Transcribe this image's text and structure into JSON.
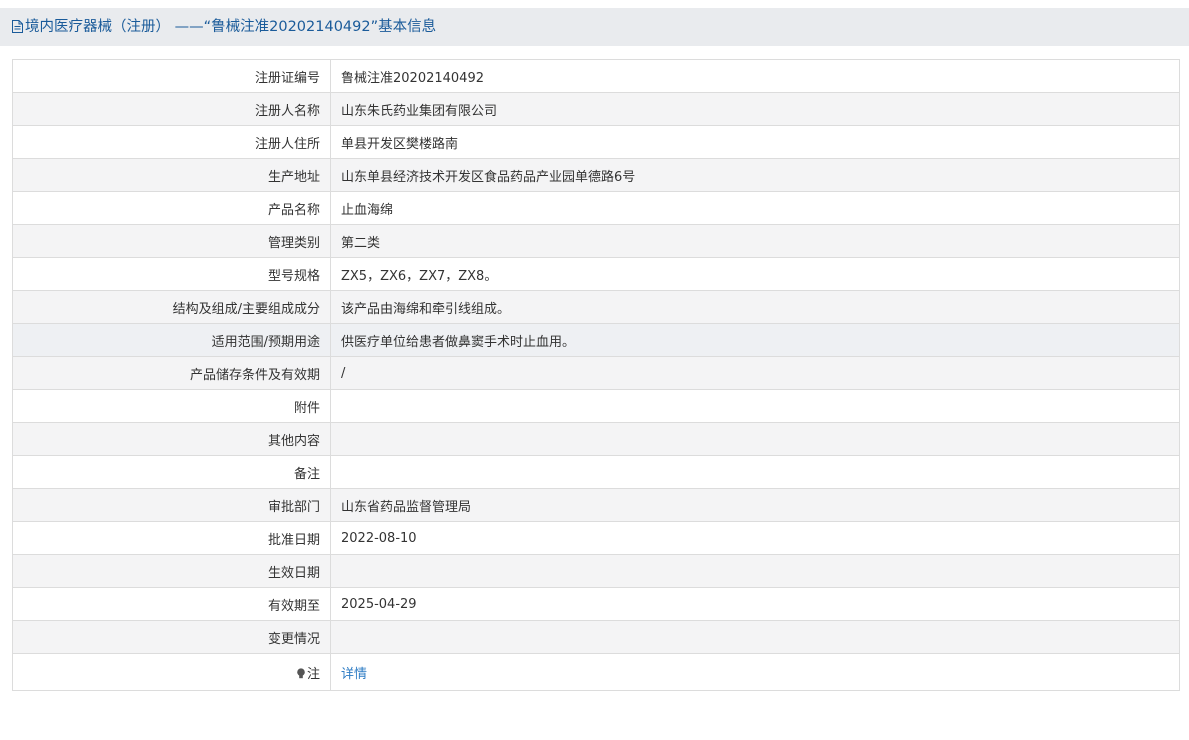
{
  "header": {
    "title": "境内医疗器械（注册） ——“鲁械注准20202140492”基本信息"
  },
  "rows": [
    {
      "label": "注册证编号",
      "value": "鲁械注准20202140492"
    },
    {
      "label": "注册人名称",
      "value": "山东朱氏药业集团有限公司"
    },
    {
      "label": "注册人住所",
      "value": "单县开发区樊楼路南"
    },
    {
      "label": "生产地址",
      "value": "山东单县经济技术开发区食品药品产业园单德路6号"
    },
    {
      "label": "产品名称",
      "value": "止血海绵"
    },
    {
      "label": "管理类别",
      "value": "第二类"
    },
    {
      "label": "型号规格",
      "value": "ZX5，ZX6，ZX7，ZX8。"
    },
    {
      "label": "结构及组成/主要组成成分",
      "value": "该产品由海绵和牵引线组成。"
    },
    {
      "label": "适用范围/预期用途",
      "value": "供医疗单位给患者做鼻窦手术时止血用。"
    },
    {
      "label": "产品储存条件及有效期",
      "value": "/"
    },
    {
      "label": "附件",
      "value": ""
    },
    {
      "label": "其他内容",
      "value": ""
    },
    {
      "label": "备注",
      "value": ""
    },
    {
      "label": "审批部门",
      "value": "山东省药品监督管理局"
    },
    {
      "label": "批准日期",
      "value": "2022-08-10"
    },
    {
      "label": "生效日期",
      "value": ""
    },
    {
      "label": "有效期至",
      "value": "2025-04-29"
    },
    {
      "label": "变更情况",
      "value": ""
    }
  ],
  "note": {
    "icon": "lightbulb-icon",
    "label": "注",
    "link_text": "详情"
  },
  "colors": {
    "header_text": "#1a5b9a",
    "link": "#2e7cc4",
    "border": "#dcdcdc"
  }
}
